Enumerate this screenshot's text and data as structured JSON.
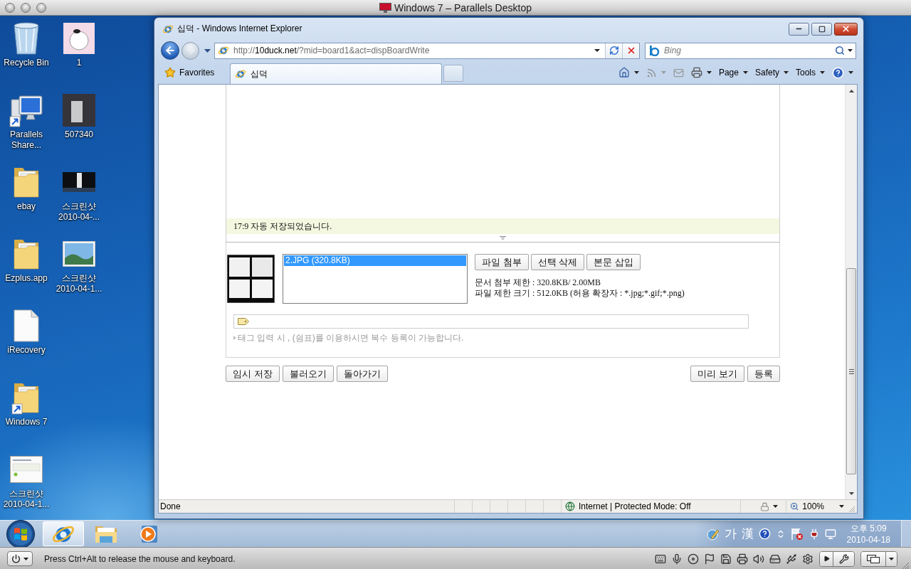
{
  "mac_window": {
    "title": "Windows 7 – Parallels Desktop"
  },
  "desktop_icons": [
    {
      "label": "Recycle Bin",
      "kind": "recycle",
      "shortcut": false
    },
    {
      "label": "Parallels Share...",
      "kind": "computer",
      "shortcut": true
    },
    {
      "label": "ebay",
      "kind": "folder",
      "shortcut": false
    },
    {
      "label": "Ezplus.app",
      "kind": "folder",
      "shortcut": false
    },
    {
      "label": "iRecovery",
      "kind": "file",
      "shortcut": false
    },
    {
      "label": "Windows 7",
      "kind": "folder",
      "shortcut": true
    },
    {
      "label": "스크린샷 2010-04-1...",
      "kind": "snapshot",
      "shortcut": false
    },
    {
      "label": "1",
      "kind": "cartoon",
      "shortcut": false
    },
    {
      "label": "507340",
      "kind": "photo",
      "shortcut": false
    },
    {
      "label": "스크린샷 2010-04-...",
      "kind": "banner",
      "shortcut": false
    },
    {
      "label": "스크린샷 2010-04-1...",
      "kind": "landscape",
      "shortcut": false
    }
  ],
  "browser": {
    "title": "십덕 - Windows Internet Explorer",
    "address": "http://**10duck.net**/?mid=board1&act=dispBoardWrite",
    "search": {
      "placeholder": "Bing"
    },
    "favorites": "Favorites",
    "tabs": [
      {
        "label": "십덕",
        "selected": true
      }
    ],
    "menus": [
      "Page",
      "Safety",
      "Tools"
    ],
    "page": {
      "autosave": "17:9 자동 저장되었습니다.",
      "files": [
        {
          "name": "2.JPG (320.8KB)",
          "selected": true
        }
      ],
      "file_buttons": [
        "파일 첨부",
        "선택 삭제",
        "본문 삽입"
      ],
      "limits": [
        "문서 첨부 제한 : 320.8KB/ 2.00MB",
        "파일 제한 크기 : 512.0KB (허용 확장자 : *.jpg;*.gif;*.png)"
      ],
      "tag_hint": "태그 입력 시 , (쉼표)를 이용하시면 복수 등록이 가능합니다.",
      "left_buttons": [
        "임시 저장",
        "불러오기",
        "돌아가기"
      ],
      "right_buttons": [
        "미리 보기",
        "등록"
      ]
    },
    "status_bar": {
      "text": "Done",
      "zone": "Internet | Protected Mode: Off",
      "zoom": "100%"
    }
  },
  "taskbar": {
    "apps": [
      {
        "kind": "browser",
        "selected": true
      },
      {
        "kind": "explorer",
        "selected": false
      },
      {
        "kind": "media",
        "selected": false
      }
    ],
    "input_mode": [
      "가",
      "漢"
    ],
    "time": "오후 5:09",
    "date": "2010-04-18"
  },
  "vm_bar": {
    "message": "Press Ctrl+Alt to release the mouse and keyboard."
  }
}
